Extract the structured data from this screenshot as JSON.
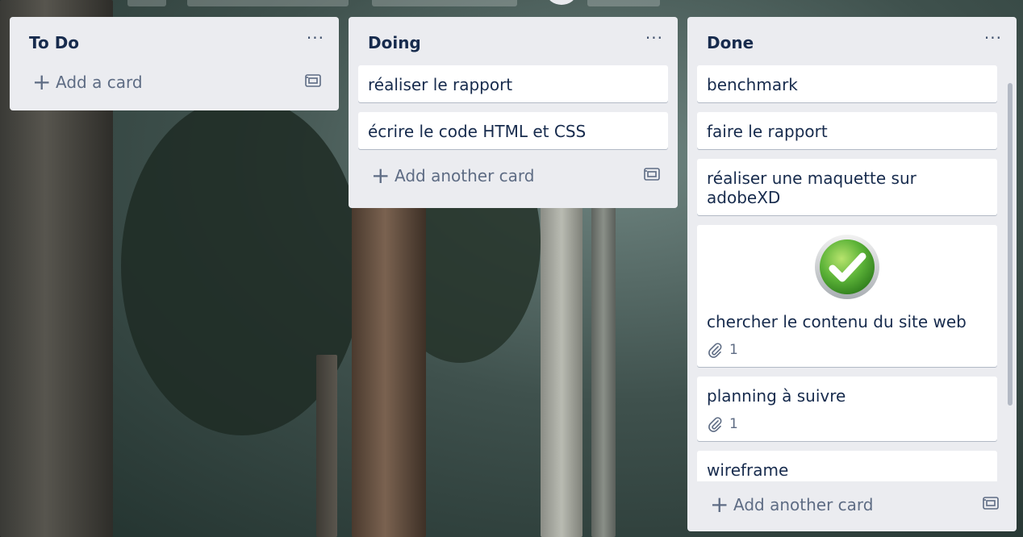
{
  "board": {
    "lists": [
      {
        "title": "To Do",
        "menu": "···",
        "cards": [],
        "add_label": "Add a card"
      },
      {
        "title": "Doing",
        "menu": "···",
        "cards": [
          "réaliser le rapport",
          "écrire le code HTML et CSS"
        ],
        "add_label": "Add another card"
      },
      {
        "title": "Done",
        "menu": "···",
        "cards": [
          {
            "text": "benchmark"
          },
          {
            "text": "faire le rapport"
          },
          {
            "text": "réaliser une maquette sur adobeXD"
          },
          {
            "text": "chercher le contenu du site web",
            "attachments": "1",
            "cover": "check-icon"
          },
          {
            "text": "planning à suivre",
            "attachments": "1"
          },
          {
            "text": "wireframe"
          }
        ],
        "add_label": "Add another card"
      }
    ]
  },
  "icons": {
    "plus": "+",
    "check_color": "#5cb338"
  }
}
